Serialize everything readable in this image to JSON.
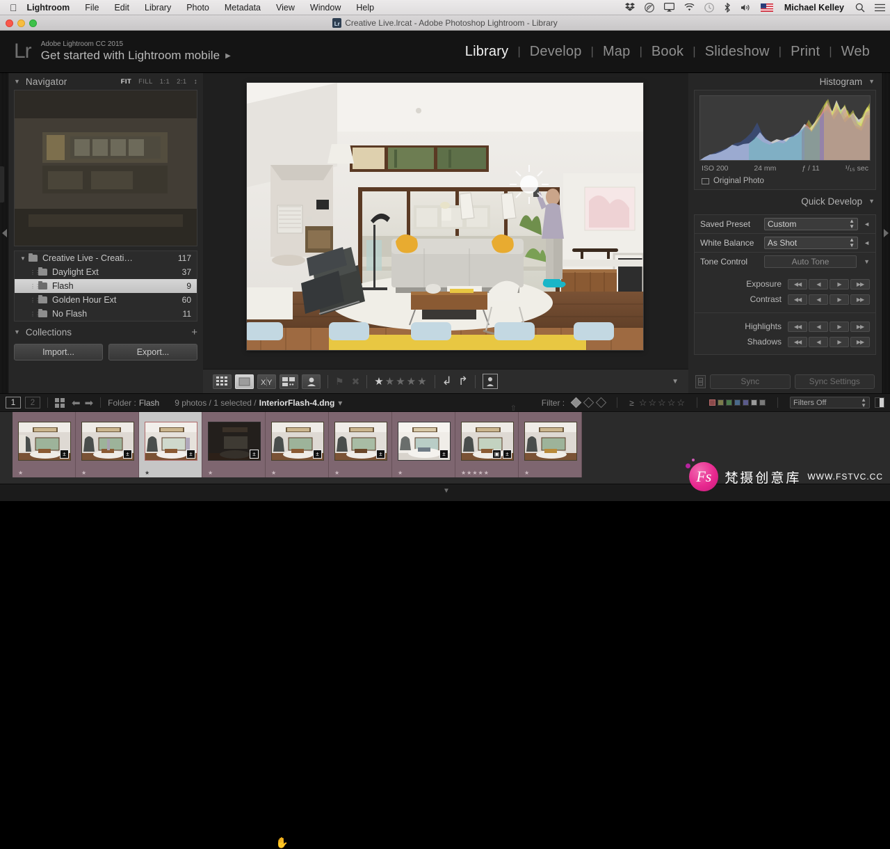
{
  "macbar": {
    "apple_icon": "apple-icon",
    "menus": [
      "Lightroom",
      "File",
      "Edit",
      "Library",
      "Photo",
      "Metadata",
      "View",
      "Window",
      "Help"
    ],
    "status_icons": [
      "dropbox-icon",
      "creative-cloud-icon",
      "airplay-icon",
      "wifi-icon",
      "timemachine-icon",
      "bluetooth-icon",
      "volume-icon",
      "flag-icon"
    ],
    "user_name": "Michael Kelley",
    "search_icon": "search-icon",
    "notification_icon": "notification-center-icon"
  },
  "titlebar": {
    "title": "Creative Live.lrcat - Adobe Photoshop Lightroom - Library",
    "app_icon": "lightroom-catalog-icon"
  },
  "identity": {
    "logo": "Lr",
    "product": "Adobe Lightroom CC 2015",
    "tagline": "Get started with Lightroom mobile",
    "arrow": "▶"
  },
  "modules": {
    "items": [
      "Library",
      "Develop",
      "Map",
      "Book",
      "Slideshow",
      "Print",
      "Web"
    ],
    "active": "Library"
  },
  "navigator": {
    "title": "Navigator",
    "triangle": "▼",
    "modes": [
      "FIT",
      "FILL",
      "1:1",
      "2:1"
    ],
    "active_mode": "FIT",
    "stepper": "↕"
  },
  "folders": {
    "rows": [
      {
        "name": "Creative Live - Creati…",
        "count": "117",
        "level": 0,
        "selected": false,
        "twisty": "▼"
      },
      {
        "name": "Daylight Ext",
        "count": "37",
        "level": 1,
        "selected": false,
        "twisty": ""
      },
      {
        "name": "Flash",
        "count": "9",
        "level": 1,
        "selected": true,
        "twisty": ""
      },
      {
        "name": "Golden Hour Ext",
        "count": "60",
        "level": 1,
        "selected": false,
        "twisty": ""
      },
      {
        "name": "No Flash",
        "count": "11",
        "level": 1,
        "selected": false,
        "twisty": ""
      }
    ]
  },
  "collections": {
    "title": "Collections",
    "triangle": "▼",
    "plus": "+"
  },
  "left_buttons": {
    "import": "Import...",
    "export": "Export..."
  },
  "toolbar": {
    "view_grid": "grid-view-icon",
    "view_loupe": "loupe-view-icon",
    "view_compare": "compare-view-icon",
    "view_survey": "survey-view-icon",
    "view_people": "people-view-icon",
    "flag_pick": "flag-pick-icon",
    "flag_reject": "flag-reject-icon",
    "rating_filled": 1,
    "rating_total": 5,
    "rotate_left": "rotate-left-icon",
    "rotate_right": "rotate-right-icon",
    "painter": "painter-icon",
    "caret": "▼"
  },
  "histogram": {
    "title": "Histogram",
    "triangle": "▼",
    "iso": "ISO 200",
    "focal": "24 mm",
    "aperture": "ƒ / 11",
    "shutter": "¹/₁₅ sec",
    "original_photo": "Original Photo"
  },
  "quick_develop": {
    "title": "Quick Develop",
    "triangle": "▼",
    "rows": [
      {
        "label": "Saved Preset",
        "value": "Custom",
        "type": "select"
      },
      {
        "label": "White Balance",
        "value": "As Shot",
        "type": "select"
      },
      {
        "label": "Tone Control",
        "value": "Auto Tone",
        "type": "button"
      }
    ],
    "sliders": [
      {
        "label": "Exposure"
      },
      {
        "label": "Contrast"
      },
      {
        "label": "Highlights"
      },
      {
        "label": "Shadows"
      }
    ],
    "slider_buttons": [
      "◀◀",
      "◀",
      "▶",
      "▶▶"
    ]
  },
  "right_bottom": {
    "sync_icon": "sync-icon",
    "sync": "Sync",
    "sync_settings": "Sync Settings"
  },
  "filmstrip_bar": {
    "page_1": "1",
    "page_2": "2",
    "grid_icon": "grid-icon",
    "back_icon": "back-arrow-icon",
    "forward_icon": "forward-arrow-icon",
    "folder_label": "Folder :",
    "folder_value": "Flash",
    "photos_text": "9 photos / 1 selected /",
    "filename": "InteriorFlash-4.dng",
    "filename_caret": "▾",
    "filter_label": "Filter :",
    "filter_flags": [
      "flag-pick-icon",
      "flag-neutral-icon",
      "flag-reject-icon"
    ],
    "rating_op": "≥",
    "rating_stars": 5,
    "color_chips": [
      "#8a4a4a",
      "#7c7c4c",
      "#4c7c4c",
      "#4a6a8a",
      "#5a5a8a",
      "#9a9a9a",
      "#7a7a7a"
    ],
    "filters_select": "Filters Off",
    "switch_icon": "filter-switch-icon"
  },
  "filmstrip": {
    "cells": [
      {
        "selected": false,
        "dark": false,
        "stars": 1,
        "badges": [
          "develop-badge"
        ]
      },
      {
        "selected": false,
        "dark": false,
        "stars": 1,
        "badges": [
          "develop-badge"
        ]
      },
      {
        "selected": true,
        "dark": false,
        "stars": 1,
        "badges": [
          "develop-badge"
        ]
      },
      {
        "selected": false,
        "dark": true,
        "stars": 1,
        "badges": [
          "develop-badge"
        ]
      },
      {
        "selected": false,
        "dark": false,
        "stars": 1,
        "badges": [
          "develop-badge"
        ]
      },
      {
        "selected": false,
        "dark": false,
        "stars": 1,
        "badges": [
          "develop-badge"
        ]
      },
      {
        "selected": false,
        "dark": false,
        "stars": 1,
        "badges": [
          "develop-badge"
        ]
      },
      {
        "selected": false,
        "dark": false,
        "stars": 5,
        "badges": [
          "crop-badge",
          "develop-badge"
        ]
      },
      {
        "selected": false,
        "dark": false,
        "stars": 1,
        "badges": []
      }
    ],
    "sort_badge": "sort-ascending-icon",
    "cursor": "hand-cursor-icon"
  },
  "watermark": {
    "logo": "Fs",
    "chinese": "梵摄创意库",
    "url": "WWW.FSTVC.CC"
  },
  "bottom": {
    "caret": "▼"
  },
  "colors": {
    "panel_bg": "#262626",
    "app_bg": "#1b1b1b",
    "filmstrip_cell": "#7e6670",
    "selection": "#c6c6c6",
    "accent_text": "#f2f2f2"
  }
}
